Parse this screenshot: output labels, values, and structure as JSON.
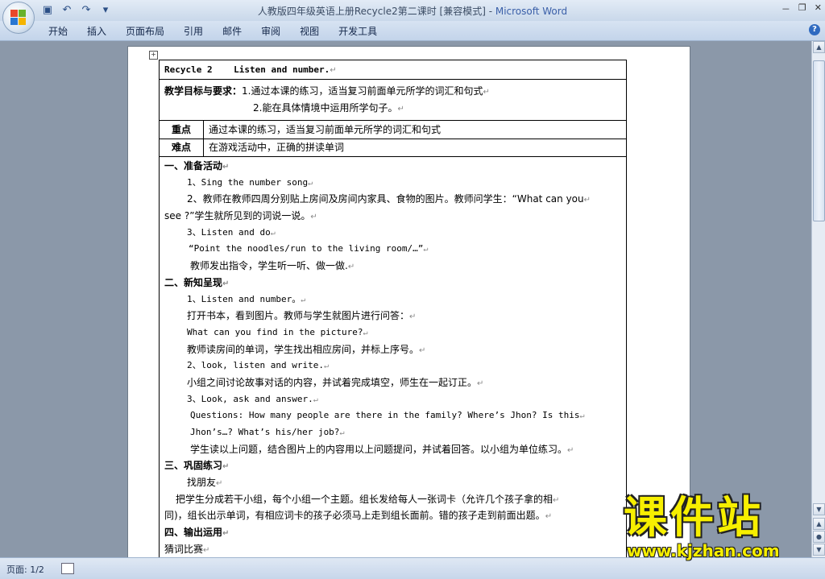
{
  "window": {
    "title": "人教版四年级英语上册Recycle2第二课时 [兼容模式] - ",
    "app_name": "Microsoft Word",
    "controls": [
      "－",
      "❐",
      "✕"
    ]
  },
  "ribbon": {
    "tabs": [
      "开始",
      "插入",
      "页面布局",
      "引用",
      "邮件",
      "审阅",
      "视图",
      "开发工具"
    ],
    "help": "?"
  },
  "quick_access": [
    "save-icon",
    "undo-icon",
    "redo-icon",
    "customize-icon"
  ],
  "document": {
    "header": "Recycle 2    Listen and number.",
    "goals_label": "教学目标与要求：",
    "goal1": "1.通过本课的练习，适当复习前面单元所学的词汇和句式",
    "goal2": "2.能在具体情境中运用所学句子。",
    "key_label": "重点",
    "key_value": "通过本课的练习，适当复习前面单元所学的词汇和句式",
    "difficulty_label": "难点",
    "difficulty_value": "在游戏活动中，正确的拼读单词",
    "body": [
      {
        "text": "一、准备活动",
        "style": "bold",
        "indent": 6
      },
      {
        "text": "1、Sing the number song",
        "style": "mono",
        "indent": 34
      },
      {
        "text": "2、教师在教师四周分别贴上房间及房间内家具、食物的图片。教师问学生：“What can you",
        "style": "",
        "indent": 34
      },
      {
        "text": "see ?”学生就所见到的词说一说。",
        "style": "",
        "indent": 6
      },
      {
        "text": "3、Listen and do",
        "style": "mono",
        "indent": 34
      },
      {
        "text": "“Point the noodles/run to the living room/…”",
        "style": "mono",
        "indent": 36
      },
      {
        "text": "教师发出指令，学生听一听、做一做.",
        "style": "",
        "indent": 38
      },
      {
        "text": "二、新知呈现",
        "style": "bold",
        "indent": 6
      },
      {
        "text": "1、Listen and number。",
        "style": "mono",
        "indent": 34
      },
      {
        "text": "打开书本，看到图片。教师与学生就图片进行问答：",
        "style": "",
        "indent": 34
      },
      {
        "text": "What can you find in the picture?",
        "style": "mono",
        "indent": 34
      },
      {
        "text": "教师读房间的单词，学生找出相应房间，并标上序号。",
        "style": "",
        "indent": 34
      },
      {
        "text": "2、look, listen and write.",
        "style": "mono",
        "indent": 34
      },
      {
        "text": "小组之间讨论故事对话的内容，并试着完成填空，师生在一起订正。",
        "style": "",
        "indent": 34
      },
      {
        "text": "3、Look, ask and answer.",
        "style": "mono",
        "indent": 34
      },
      {
        "text": "Questions: How many people are there in the family?  Where’s Jhon? Is this",
        "style": "mono",
        "indent": 38
      },
      {
        "text": "Jhon’s…? What’s his/her job?",
        "style": "mono",
        "indent": 38
      },
      {
        "text": "学生读以上问题，结合图片上的内容用以上问题提问，并试着回答。以小组为单位练习。",
        "style": "",
        "indent": 38
      },
      {
        "text": "三、巩固练习",
        "style": "bold",
        "indent": 6
      },
      {
        "text": "找朋友",
        "style": "",
        "indent": 34
      },
      {
        "text": "把学生分成若干小组，每个小组一个主题。组长发给每人一张词卡（允许几个孩子拿的相",
        "style": "",
        "indent": 20
      },
      {
        "text": "同)，组长出示单词，有相应词卡的孩子必须马上走到组长面前。错的孩子走到前面出题。",
        "style": "",
        "indent": 6
      },
      {
        "text": "四、输出运用",
        "style": "bold",
        "indent": 6
      },
      {
        "text": "猜词比赛",
        "style": "",
        "indent": 6
      }
    ]
  },
  "status": {
    "page": "页面: 1/2"
  },
  "watermark": {
    "text": "课件站",
    "url": "www.kjzhan.com"
  }
}
